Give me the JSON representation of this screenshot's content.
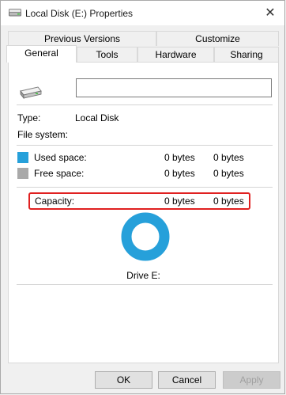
{
  "window": {
    "title": "Local Disk (E:) Properties",
    "close_symbol": "✕"
  },
  "tabs_back": [
    {
      "label": "Previous Versions"
    },
    {
      "label": "Customize"
    }
  ],
  "tabs_front": [
    {
      "label": "General",
      "active": true
    },
    {
      "label": "Tools"
    },
    {
      "label": "Hardware"
    },
    {
      "label": "Sharing"
    }
  ],
  "general": {
    "drive_name_value": "",
    "type_label": "Type:",
    "type_value": "Local Disk",
    "filesystem_label": "File system:",
    "filesystem_value": "",
    "used_label": "Used space:",
    "used_bytes": "0 bytes",
    "used_size": "0 bytes",
    "free_label": "Free space:",
    "free_bytes": "0 bytes",
    "free_size": "0 bytes",
    "capacity_label": "Capacity:",
    "capacity_bytes": "0 bytes",
    "capacity_size": "0 bytes",
    "drive_label": "Drive E:"
  },
  "colors": {
    "used": "#26a0da",
    "free": "#a9a9a9",
    "highlight": "#e02020"
  },
  "buttons": {
    "ok": "OK",
    "cancel": "Cancel",
    "apply": "Apply"
  },
  "icons": {
    "title": "drive-icon",
    "drive": "drive-icon",
    "close": "close-icon"
  }
}
